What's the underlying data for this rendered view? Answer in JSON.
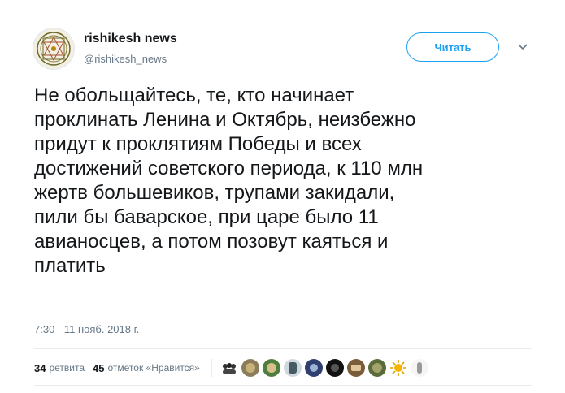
{
  "user": {
    "display_name": "rishikesh news",
    "handle": "@rishikesh_news"
  },
  "follow_button": {
    "label": "Читать"
  },
  "tweet": {
    "lines": [
      "Не обольщайтесь, те, кто начинает",
      "проклинать Ленина и Октябрь, неизбежно",
      "придут к проклятиям Победы и всех",
      "достижений советского периода, к 110 млн",
      "жертв большевиков, трупами закидали,",
      "пили бы баварское, при царе было 11",
      "авианосцев, а потом позовут каяться и",
      "платить"
    ],
    "timestamp": "7:30 - 11 нояб. 2018 г."
  },
  "stats": {
    "retweets_count": "34",
    "retweets_label": "ретвита",
    "likes_count": "45",
    "likes_label": "отметок «Нравится»"
  },
  "icons": {
    "avatar": "yantra-emblem-icon",
    "caret": "chevron-down-icon"
  },
  "colors": {
    "accent": "#1da1f2",
    "text": "#14171a",
    "secondary": "#657786",
    "divider": "#e6ecf0"
  }
}
